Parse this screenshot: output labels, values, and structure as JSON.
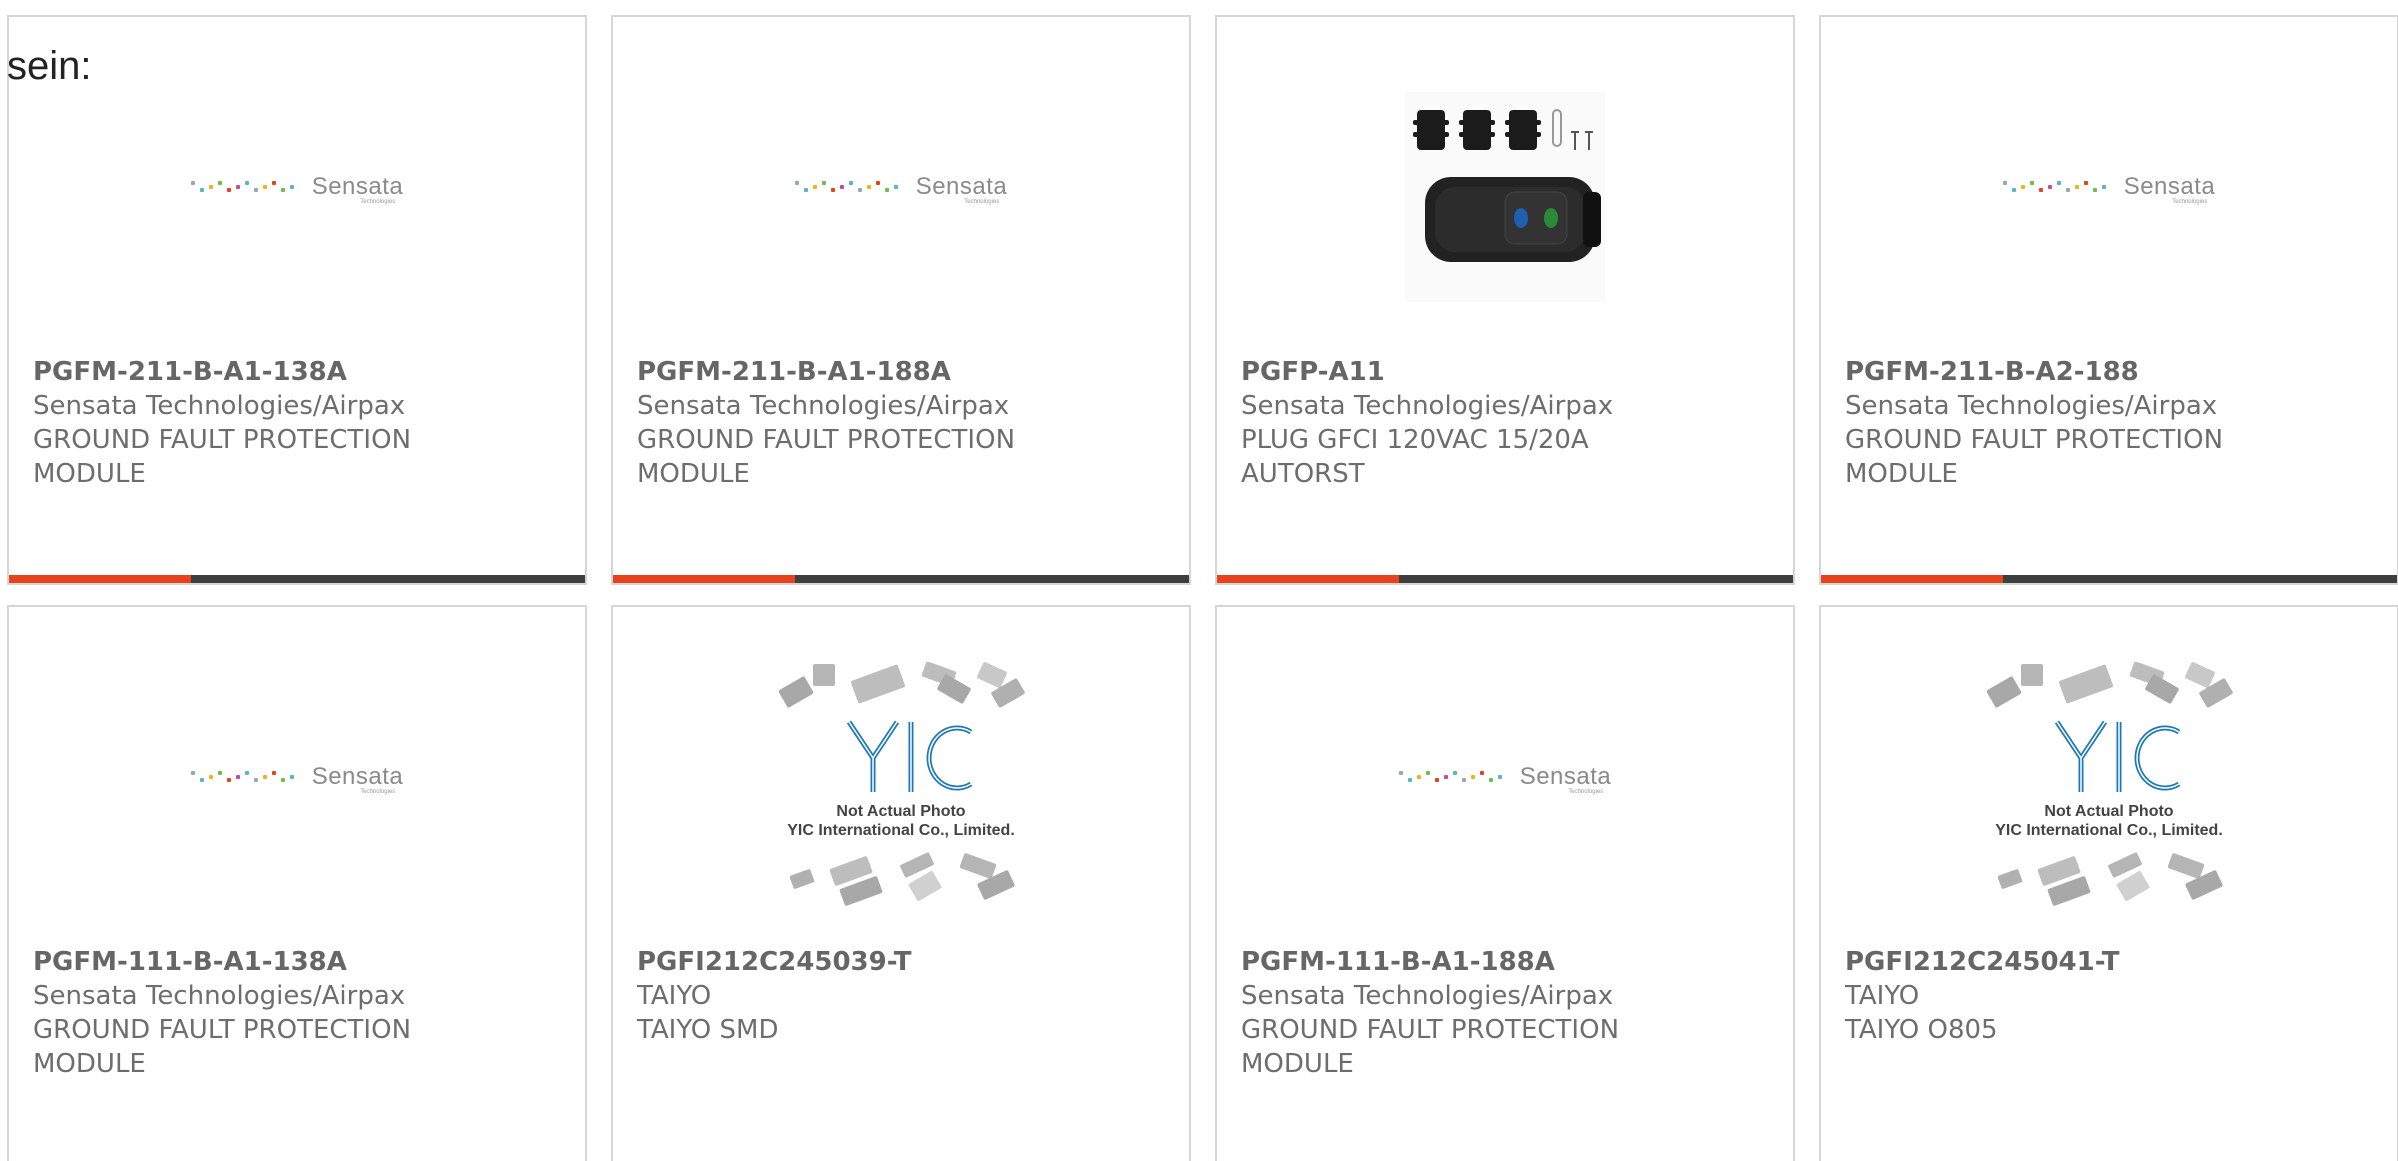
{
  "intro": {
    "text": "sein:"
  },
  "colors": {
    "accent": "#e8421c",
    "bar": "#3e3e3e",
    "text": "#666666"
  },
  "products": [
    {
      "part_number": "PGFM-211-B-A1-138A",
      "manufacturer": "Sensata Technologies/Airpax",
      "description": "GROUND FAULT PROTECTION MODULE",
      "image": "sensata-logo"
    },
    {
      "part_number": "PGFM-211-B-A1-188A",
      "manufacturer": "Sensata Technologies/Airpax",
      "description": "GROUND FAULT PROTECTION MODULE",
      "image": "sensata-logo"
    },
    {
      "part_number": "PGFP-A11",
      "manufacturer": "Sensata Technologies/Airpax",
      "description": "PLUG GFCI 120VAC 15/20A AUTORST",
      "image": "gfci-plug-photo"
    },
    {
      "part_number": "PGFM-211-B-A2-188",
      "manufacturer": "Sensata Technologies/Airpax",
      "description": "GROUND FAULT PROTECTION MODULE",
      "image": "sensata-logo"
    },
    {
      "part_number": "PGFM-111-B-A1-138A",
      "manufacturer": "Sensata Technologies/Airpax",
      "description": "GROUND FAULT PROTECTION MODULE",
      "image": "sensata-logo"
    },
    {
      "part_number": "PGFI212C245039-T",
      "manufacturer": "TAIYO",
      "description": "TAIYO SMD",
      "image": "yic-placeholder"
    },
    {
      "part_number": "PGFM-111-B-A1-188A",
      "manufacturer": "Sensata Technologies/Airpax",
      "description": "GROUND FAULT PROTECTION MODULE",
      "image": "sensata-logo"
    },
    {
      "part_number": "PGFI212C245041-T",
      "manufacturer": "TAIYO",
      "description": "TAIYO O805",
      "image": "yic-placeholder"
    }
  ],
  "sensata_logo": {
    "word": "Sensata",
    "sub": "Technologies"
  },
  "yic_placeholder": {
    "mark": "YIC",
    "line1": "Not Actual Photo",
    "line2": "YIC International Co., Limited."
  }
}
